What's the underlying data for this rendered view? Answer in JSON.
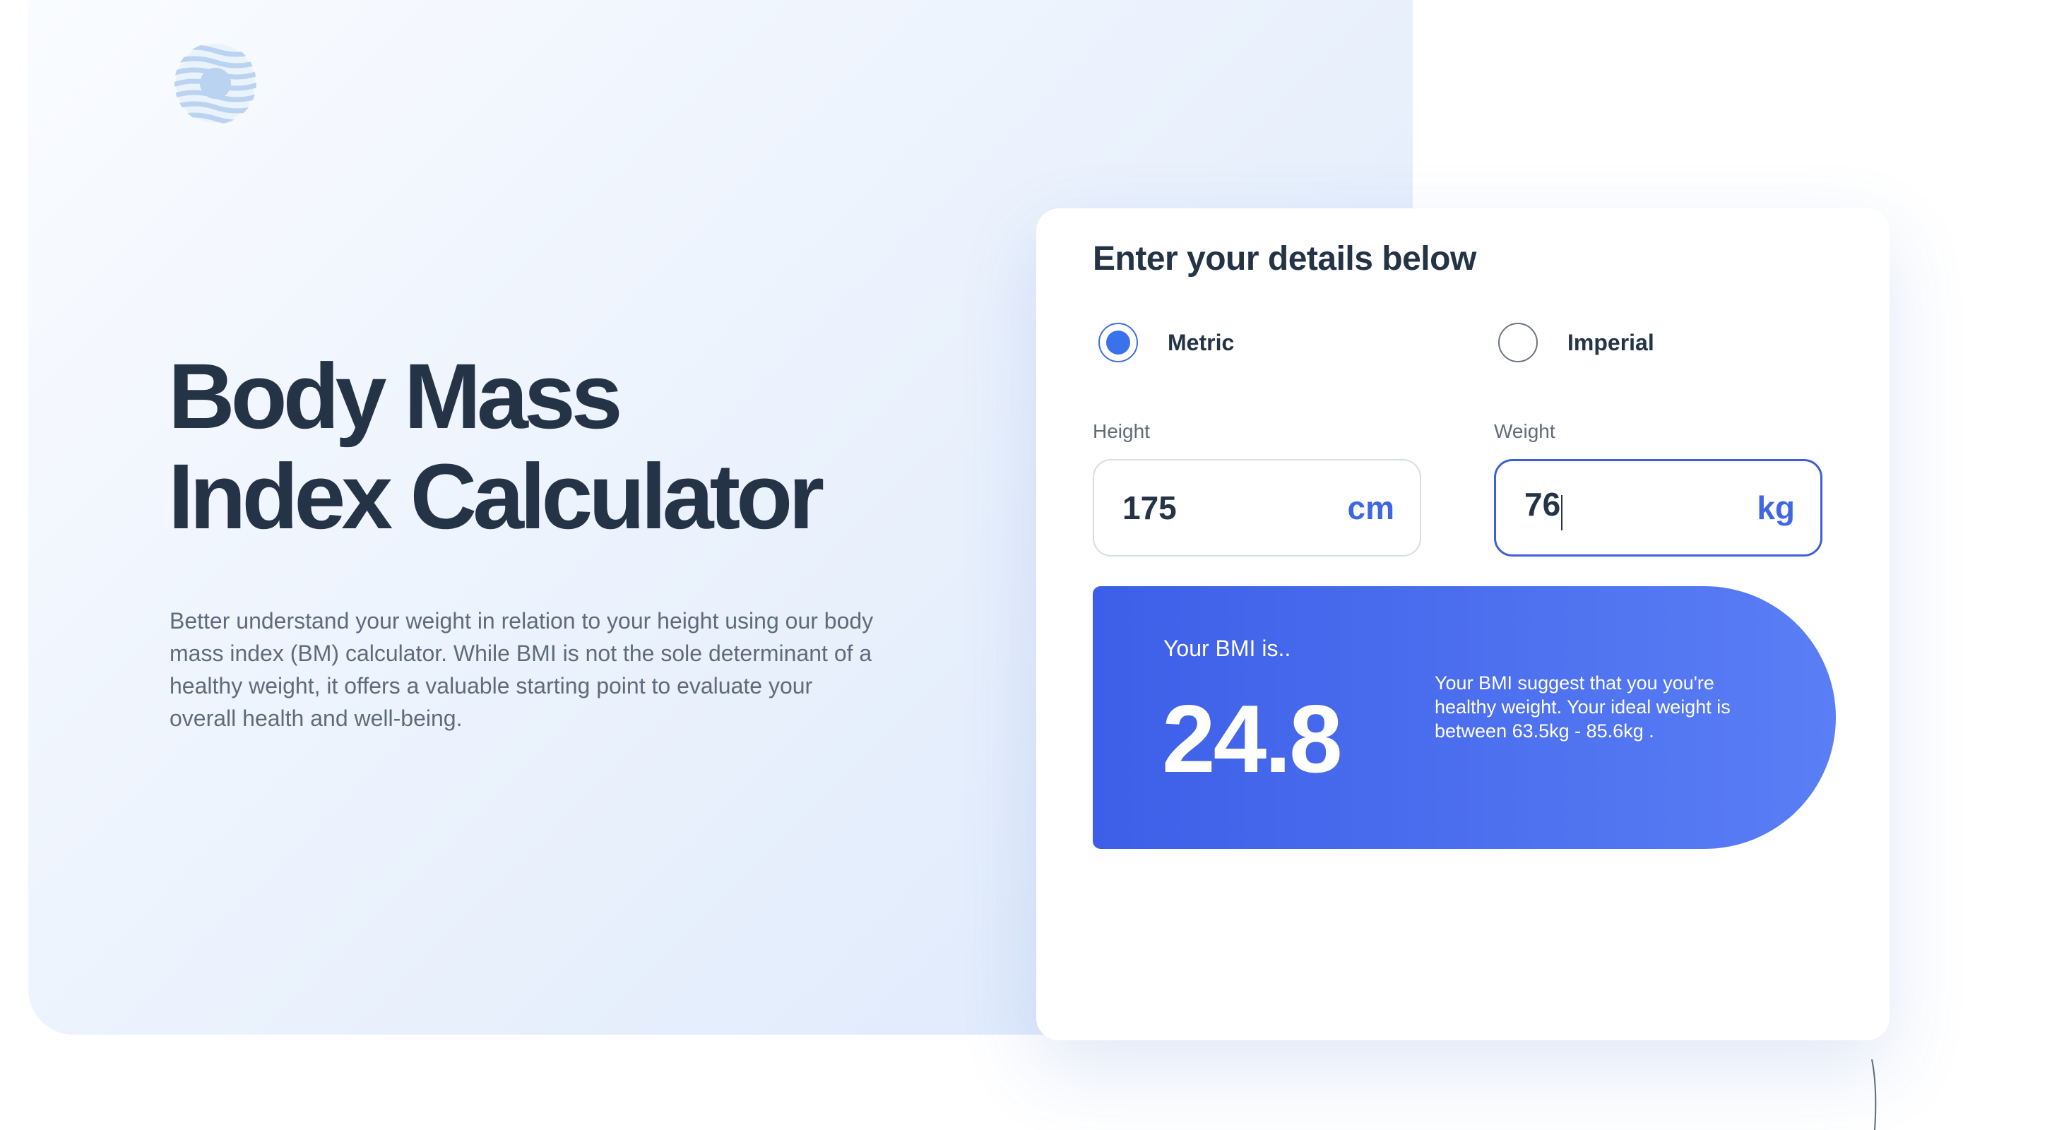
{
  "hero": {
    "title_line1": "Body Mass",
    "title_line2": "Index Calculator",
    "description": "Better understand your weight in relation to your height using our body mass index (BM) calculator. While BMI is not the sole determinant of a healthy weight, it offers a valuable starting point to evaluate your overall health and well-being."
  },
  "logo": {
    "icon": "striped-globe-logo",
    "color": "#b9d3f0"
  },
  "form": {
    "heading": "Enter your details below",
    "units": [
      {
        "label": "Metric",
        "selected": true
      },
      {
        "label": "Imperial",
        "selected": false
      }
    ],
    "height": {
      "label": "Height",
      "value": "175",
      "unit": "cm"
    },
    "weight": {
      "label": "Weight",
      "value": "76",
      "unit": "kg"
    }
  },
  "result": {
    "label": "Your BMI is..",
    "value": "24.8",
    "message": "Your BMI suggest that you you're healthy weight. Your ideal weight is between 63.5kg - 85.6kg ."
  },
  "colors": {
    "accent": "#3d5fe8",
    "accent_light": "#5a7ef5",
    "heading": "#253347",
    "body_text": "#5f6b7b"
  }
}
